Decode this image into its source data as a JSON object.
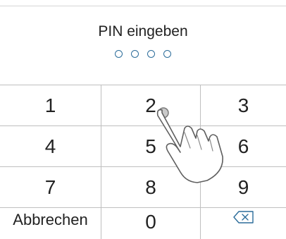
{
  "header": {
    "title": "PIN eingeben"
  },
  "pin": {
    "length": 4,
    "filled": 0
  },
  "keypad": {
    "keys": [
      "1",
      "2",
      "3",
      "4",
      "5",
      "6",
      "7",
      "8",
      "9"
    ],
    "cancel_label": "Abbrechen",
    "zero_label": "0",
    "backspace_icon": "backspace-icon"
  },
  "overlay": {
    "icon": "tap-hand-icon"
  },
  "colors": {
    "dot_outline": "#2b6c9a",
    "divider": "#bfbfbf",
    "text": "#222222",
    "background": "#ffffff"
  }
}
